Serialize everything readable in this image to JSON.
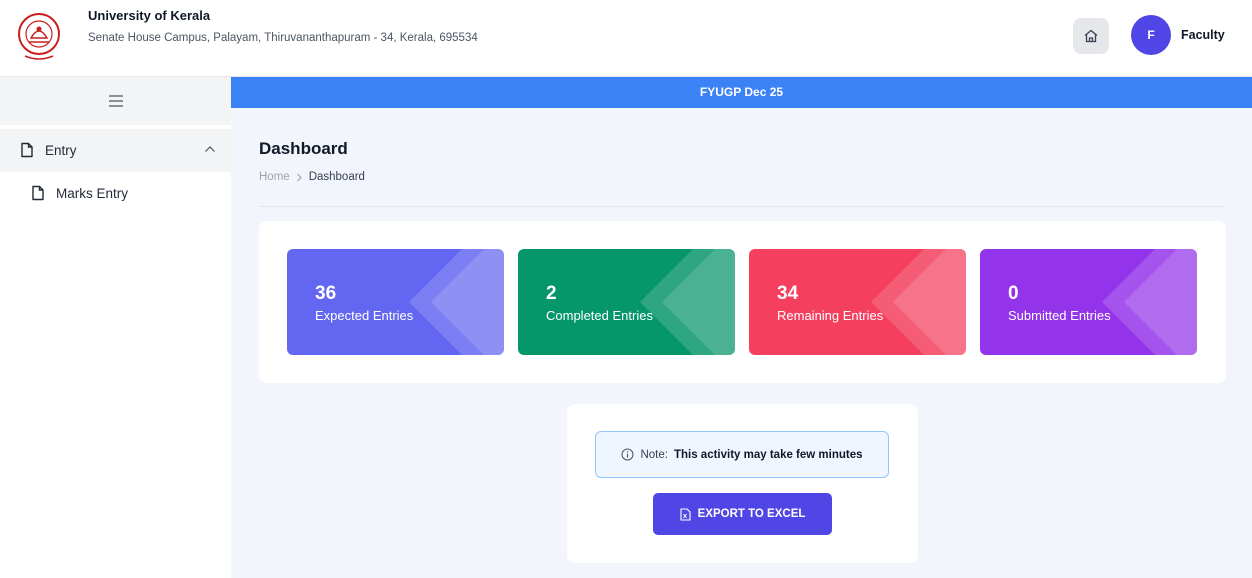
{
  "header": {
    "university_name": "University of Kerala",
    "address_line": "Senate House Campus, Palayam, Thiruvananthapuram - 34, Kerala, 695534",
    "logo_icon": "university-seal-icon",
    "home_icon": "home-icon",
    "avatar_letter": "F",
    "user_role": "Faculty"
  },
  "sidebar": {
    "menu_icon": "hamburger-menu-icon",
    "group_label": "Entry",
    "group_icon": "file-icon",
    "group_chevron": "chevron-up-icon",
    "items": [
      {
        "label": "Marks Entry",
        "icon": "file-icon"
      }
    ]
  },
  "banner": {
    "text": "FYUGP Dec 25"
  },
  "page": {
    "title": "Dashboard",
    "breadcrumb": {
      "home": "Home",
      "separator_icon": "chevron-right-icon",
      "current": "Dashboard"
    }
  },
  "stats": [
    {
      "value": "36",
      "label": "Expected Entries",
      "color": "#6366f1"
    },
    {
      "value": "2",
      "label": "Completed Entries",
      "color": "#059669"
    },
    {
      "value": "34",
      "label": "Remaining Entries",
      "color": "#f43f5e"
    },
    {
      "value": "0",
      "label": "Submitted Entries",
      "color": "#9333ea"
    }
  ],
  "export": {
    "note_prefix": "Note:",
    "note_text": "This activity may take few minutes",
    "info_icon": "info-icon",
    "button_label": "EXPORT TO EXCEL",
    "button_icon": "excel-file-icon",
    "button_color": "#4f46e5"
  }
}
